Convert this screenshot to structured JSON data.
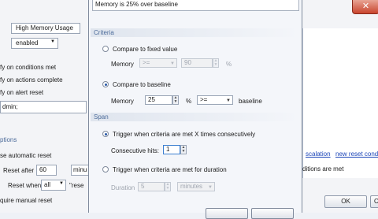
{
  "background_left": {
    "name_value": "High Memory Usage",
    "enabled_option": "enabled",
    "notify_conditions": "fy on conditions met",
    "notify_actions": "fy on actions complete",
    "notify_alert_reset": "fy on alert reset",
    "admin_value": "dmin;",
    "options_heading": "ptions",
    "use_auto_reset": "se automatic reset",
    "reset_after_label": "Reset after",
    "reset_after_value": "60",
    "reset_after_unit": "minu",
    "reset_when_label": "Reset when",
    "reset_when_value": "all",
    "reset_when_suffix": "\"rese",
    "manual_reset": "quire manual reset"
  },
  "background_right": {
    "escalation_link": "scalation",
    "new_reset_link": "new reset cond",
    "options_met_text": "ditions are met",
    "ok_label": "OK",
    "cancel_label": "Ca"
  },
  "dialog": {
    "description": "Memory is 25% over baseline",
    "criteria": {
      "title": "Criteria",
      "fixed_label": "Compare to fixed value",
      "fixed_memory_label": "Memory",
      "fixed_operator": ">=",
      "fixed_value": "90",
      "fixed_unit": "%",
      "baseline_label": "Compare to baseline",
      "baseline_memory_label": "Memory",
      "baseline_value": "25",
      "baseline_unit": "%",
      "baseline_operator": ">=",
      "baseline_suffix": "baseline"
    },
    "span": {
      "title": "Span",
      "consecutive_label": "Trigger when criteria are met X times consecutively",
      "hits_label": "Consecutive hits:",
      "hits_value": "1",
      "duration_option_label": "Trigger when criteria are met for duration",
      "duration_label": "Duration",
      "duration_value": "5",
      "duration_unit": "minutes"
    }
  }
}
